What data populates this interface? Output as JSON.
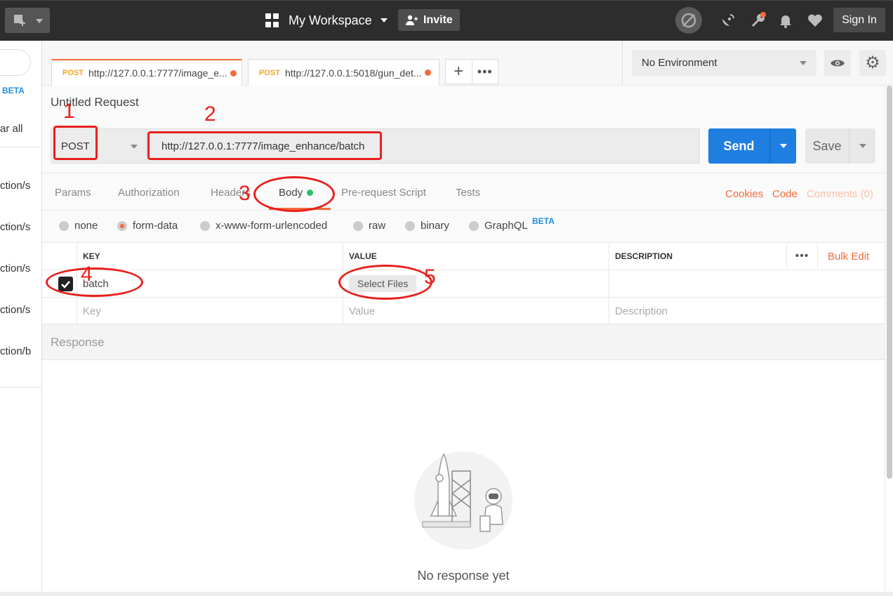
{
  "topbar": {
    "workspace": "My Workspace",
    "invite": "Invite",
    "sign_in": "Sign In"
  },
  "sidebar": {
    "beta": "BETA",
    "clear_all": "ar all",
    "items": [
      "ction/s",
      "ction/s",
      "ction/s",
      "ction/s",
      "ction/b"
    ]
  },
  "tabs": [
    {
      "method": "POST",
      "url": "http://127.0.0.1:7777/image_e...",
      "active": true
    },
    {
      "method": "POST",
      "url": "http://127.0.0.1:5018/gun_det...",
      "active": false
    }
  ],
  "environment": {
    "selected": "No Environment"
  },
  "request": {
    "title": "Untitled Request",
    "method": "POST",
    "url": "http://127.0.0.1:7777/image_enhance/batch",
    "send": "Send",
    "save": "Save"
  },
  "subtabs": [
    "Params",
    "Authorization",
    "Headers",
    "Body",
    "Pre-request Script",
    "Tests"
  ],
  "subtab_active": "Body",
  "links": {
    "cookies": "Cookies",
    "code": "Code",
    "comments": "Comments (0)"
  },
  "body_modes": [
    "none",
    "form-data",
    "x-www-form-urlencoded",
    "raw",
    "binary",
    "GraphQL"
  ],
  "body_mode_selected": "form-data",
  "graphql_badge": "BETA",
  "table": {
    "headers": {
      "key": "KEY",
      "value": "VALUE",
      "description": "DESCRIPTION"
    },
    "bulk_edit": "Bulk Edit",
    "rows": [
      {
        "checked": true,
        "key": "batch",
        "value_button": "Select Files",
        "description": ""
      }
    ],
    "placeholders": {
      "key": "Key",
      "value": "Value",
      "description": "Description"
    }
  },
  "response": {
    "title": "Response",
    "empty": "No response yet"
  },
  "annotations": [
    "1",
    "2",
    "3",
    "4",
    "5"
  ],
  "colors": {
    "accent": "#f26b3a",
    "send": "#1f7fe0",
    "annotation": "#e8201c",
    "body_dot": "#2bbf6a",
    "beta": "#1f8ee6"
  }
}
